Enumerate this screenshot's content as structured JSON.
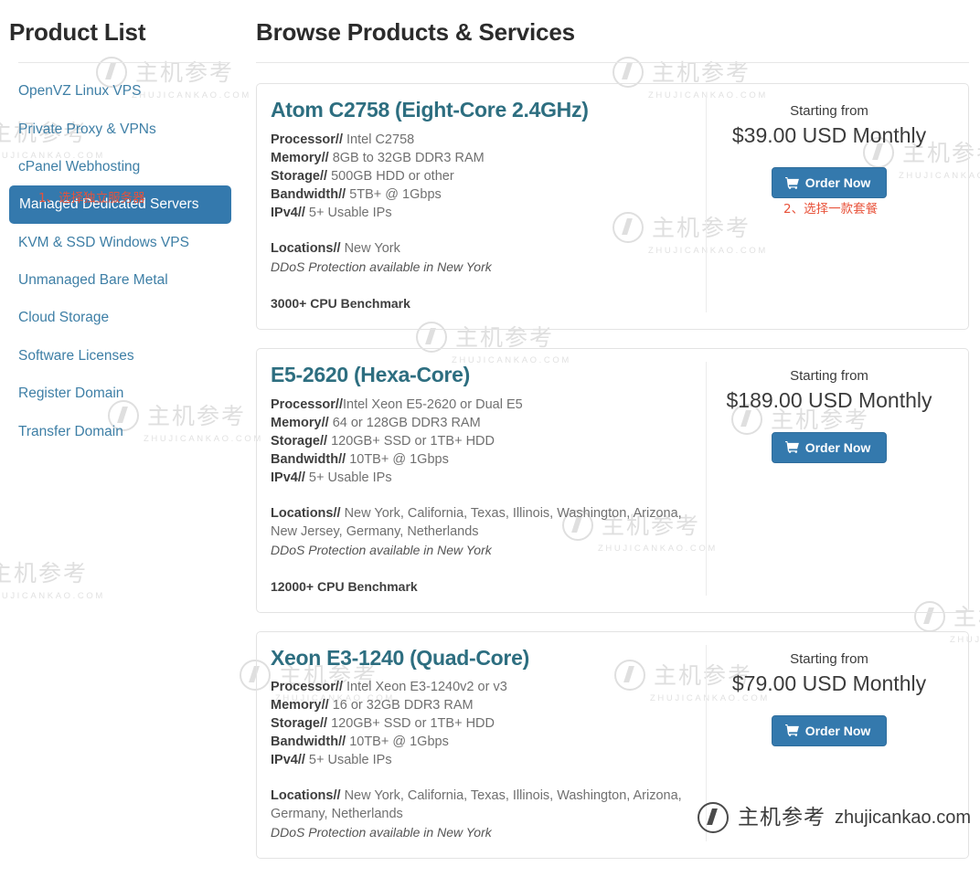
{
  "sidebar": {
    "title": "Product List",
    "items": [
      {
        "label": "OpenVZ Linux VPS",
        "active": false
      },
      {
        "label": "Private Proxy & VPNs",
        "active": false
      },
      {
        "label": "cPanel Webhosting",
        "active": false
      },
      {
        "label": "Managed Dedicated Servers",
        "active": true
      },
      {
        "label": "KVM & SSD Windows VPS",
        "active": false
      },
      {
        "label": "Unmanaged Bare Metal",
        "active": false
      },
      {
        "label": "Cloud Storage",
        "active": false
      },
      {
        "label": "Software Licenses",
        "active": false
      },
      {
        "label": "Register Domain",
        "active": false
      },
      {
        "label": "Transfer Domain",
        "active": false
      }
    ]
  },
  "main": {
    "title": "Browse Products & Services",
    "starting_from_label": "Starting from",
    "order_button_label": "Order Now",
    "products": [
      {
        "title": "Atom C2758 (Eight-Core 2.4GHz)",
        "specs": [
          {
            "label": "Processor//",
            "value": " Intel C2758"
          },
          {
            "label": "Memory//",
            "value": " 8GB to 32GB DDR3 RAM"
          },
          {
            "label": "Storage//",
            "value": " 500GB HDD or other"
          },
          {
            "label": "Bandwidth//",
            "value": " 5TB+ @ 1Gbps"
          },
          {
            "label": "IPv4//",
            "value": " 5+ Usable IPs"
          }
        ],
        "locations_label": "Locations//",
        "locations_value": " New York",
        "ddos": "DDoS Protection available in New York",
        "benchmark": "3000+ CPU Benchmark",
        "price": "$39.00 USD Monthly"
      },
      {
        "title": "E5-2620 (Hexa-Core)",
        "specs": [
          {
            "label": "Processor//",
            "value": "Intel Xeon E5-2620 or Dual E5"
          },
          {
            "label": "Memory//",
            "value": " 64 or 128GB DDR3 RAM"
          },
          {
            "label": "Storage//",
            "value": " 120GB+ SSD or 1TB+ HDD"
          },
          {
            "label": "Bandwidth//",
            "value": " 10TB+ @ 1Gbps"
          },
          {
            "label": "IPv4//",
            "value": " 5+ Usable IPs"
          }
        ],
        "locations_label": "Locations//",
        "locations_value": " New York, California, Texas, Illinois, Washington, Arizona, New Jersey, Germany, Netherlands",
        "ddos": "DDoS Protection available in New York",
        "benchmark": "12000+ CPU Benchmark",
        "price": "$189.00 USD Monthly"
      },
      {
        "title": "Xeon E3-1240 (Quad-Core)",
        "specs": [
          {
            "label": "Processor//",
            "value": " Intel Xeon E3-1240v2 or v3"
          },
          {
            "label": "Memory//",
            "value": " 16 or 32GB DDR3 RAM"
          },
          {
            "label": "Storage//",
            "value": " 120GB+ SSD or 1TB+ HDD"
          },
          {
            "label": "Bandwidth//",
            "value": " 10TB+ @ 1Gbps"
          },
          {
            "label": "IPv4//",
            "value": " 5+ Usable IPs"
          }
        ],
        "locations_label": "Locations//",
        "locations_value": " New York, California, Texas, Illinois, Washington, Arizona, Germany, Netherlands",
        "ddos": "DDoS Protection available in New York",
        "benchmark": "",
        "price": "$79.00 USD Monthly"
      }
    ]
  },
  "annotations": [
    {
      "id": "annot-1",
      "text": "1、选择独立服务器"
    },
    {
      "id": "annot-2",
      "text": "2、选择一款套餐"
    }
  ],
  "watermark": {
    "cn": "主机参考",
    "en": "ZHUJICANKAO.COM"
  },
  "brand_badge": {
    "cn": "主机参考",
    "en": "zhujicankao.com"
  },
  "colors": {
    "accent_blue": "#3479ad",
    "heading_teal": "#2d6e80",
    "link_blue": "#3e7fa6",
    "annotation_red": "#e8523a"
  }
}
